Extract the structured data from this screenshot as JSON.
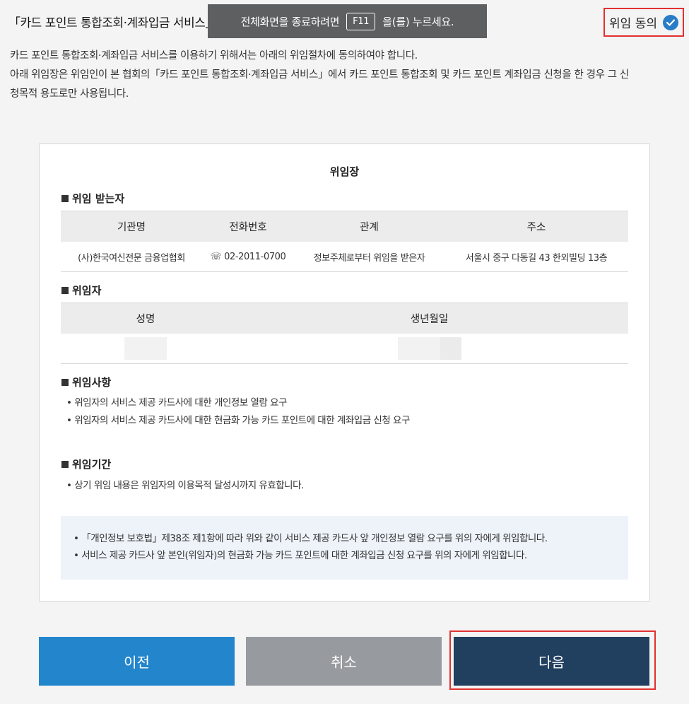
{
  "header": {
    "title": "「카드 포인트 통합조회·계좌입금 서비스」이용",
    "fullscreen_notice": {
      "before": "전체화면을 종료하려면",
      "key": "F11",
      "after": "을(를) 누르세요."
    },
    "agree_label": "위임 동의",
    "agree_checked": true
  },
  "intro": {
    "line1": "카드 포인트 통합조회·계좌입금 서비스를 이용하기 위해서는 아래의 위임절차에 동의하여야 합니다.",
    "line2": "아래 위임장은 위임인이 본 협회의「카드 포인트 통합조회·계좌입금 서비스」에서 카드 포인트 통합조회 및 카드 포인트 계좌입금 신청을 한 경우 그 신",
    "line3": "청목적 용도로만 사용됩니다."
  },
  "letter": {
    "title": "위임장",
    "delegatee": {
      "heading": "위임 받는자",
      "columns": [
        "기관명",
        "전화번호",
        "관계",
        "주소"
      ],
      "row": [
        "(사)한국여신전문 금융업협회",
        "☏ 02-2011-0700",
        "정보주체로부터 위임을 받은자",
        "서울시 중구 다동길 43 한외빌딩 13층"
      ]
    },
    "delegator": {
      "heading": "위임자",
      "columns": [
        "성명",
        "생년월일"
      ]
    },
    "matters": {
      "heading": "위임사항",
      "items": [
        "• 위임자의 서비스 제공 카드사에 대한 개인정보 열람 요구",
        "• 위임자의 서비스 제공 카드사에 대한 현금화 가능 카드 포인트에 대한 계좌입금 신청 요구"
      ]
    },
    "period": {
      "heading": "위임기간",
      "items": [
        "• 상기 위임 내용은 위임자의 이용목적 달성시까지 유효합니다."
      ]
    },
    "notice": [
      "• 「개인정보 보호법」제38조 제1항에 따라 위와 같이 서비스 제공 카드사 앞 개인정보 열람 요구를 위의 자에게 위임합니다.",
      "• 서비스 제공 카드사 앞 본인(위임자)의 현금화 가능 카드 포인트에 대한 계좌입금 신청 요구를 위의 자에게 위임합니다."
    ]
  },
  "buttons": {
    "prev": "이전",
    "cancel": "취소",
    "next": "다음"
  },
  "colors": {
    "prev": "#2386cc",
    "cancel": "#979b9f",
    "next": "#213f5f",
    "highlight": "#e23030",
    "check": "#2a7cc7"
  }
}
